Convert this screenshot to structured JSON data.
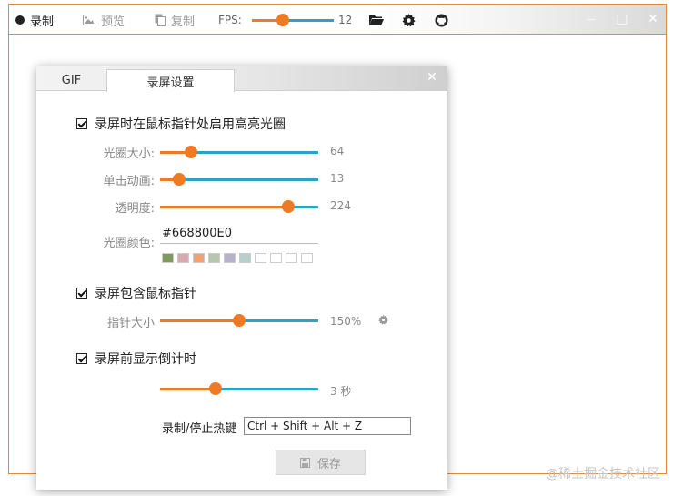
{
  "toolbar": {
    "record_label": "录制",
    "preview_label": "预览",
    "copy_label": "复制",
    "fps_label": "FPS:",
    "fps_value": "12",
    "fps_slider_fraction": 0.36,
    "icons": [
      "record-dot",
      "image-icon",
      "copy-icon",
      "folder-open-icon",
      "gear-icon",
      "github-icon"
    ]
  },
  "window_controls": {
    "minimize": "—",
    "maximize": "□",
    "close": "✕"
  },
  "dialog": {
    "tabs": [
      {
        "label": "GIF",
        "active": false
      },
      {
        "label": "录屏设置",
        "active": true
      }
    ],
    "close_label": "✕",
    "highlight": {
      "checkbox_label": "录屏时在鼠标指针处启用高亮光圈",
      "checked": true,
      "size_label": "光圈大小:",
      "size_value": "64",
      "size_fraction": 0.17,
      "click_anim_label": "单击动画:",
      "click_anim_value": "13",
      "click_anim_fraction": 0.09,
      "opacity_label": "透明度:",
      "opacity_value": "224",
      "opacity_fraction": 0.84,
      "color_label": "光圈颜色:",
      "color_value": "#668800E0",
      "swatches": [
        "#7f9a5c",
        "#d9a8b0",
        "#f4a070",
        "#b9c6ac",
        "#b7b1c9",
        "#b9cfcd",
        "#ffffff",
        "#ffffff",
        "#ffffff",
        "#ffffff"
      ]
    },
    "cursor": {
      "checkbox_label": "录屏包含鼠标指针",
      "checked": true,
      "size_label": "指针大小",
      "size_value": "150%",
      "size_fraction": 0.5
    },
    "countdown": {
      "checkbox_label": "录屏前显示倒计时",
      "checked": true,
      "value": "3 秒",
      "fraction": 0.34
    },
    "hotkey_label": "录制/停止热键",
    "hotkey_value": "Ctrl + Shift + Alt + Z",
    "save_label": "保存"
  },
  "watermark": "@稀土掘金技术社区",
  "colors": {
    "accent": "#ee7a24",
    "track": "#2aa3c6",
    "border": "#e08a3c"
  }
}
